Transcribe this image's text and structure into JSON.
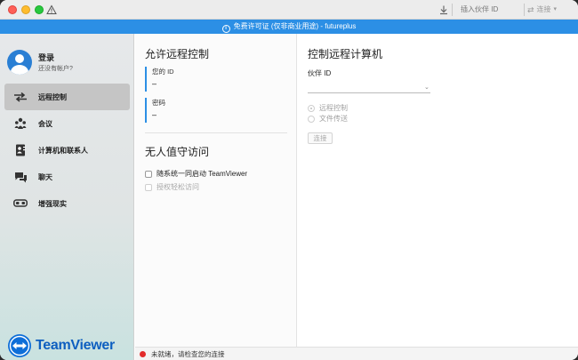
{
  "titlebar": {
    "partner_id_placeholder": "插入伙伴 ID",
    "connect_label": "连接"
  },
  "banner": {
    "text": "免费许可证 (仅非商业用途) - futureplus",
    "color": "#2c8fe5"
  },
  "profile": {
    "name": "登录",
    "subtitle": "还没有帐户?"
  },
  "sidebar": {
    "items": [
      {
        "label": "远程控制",
        "icon": "arrows-icon",
        "active": true
      },
      {
        "label": "会议",
        "icon": "people-icon",
        "active": false
      },
      {
        "label": "计算机和联系人",
        "icon": "contacts-icon",
        "active": false
      },
      {
        "label": "聊天",
        "icon": "chat-icon",
        "active": false
      },
      {
        "label": "增强现实",
        "icon": "ar-glasses-icon",
        "active": false
      }
    ],
    "logo_text": "TeamViewer"
  },
  "allow": {
    "title": "允许远程控制",
    "id_label": "您的 ID",
    "id_value": "–",
    "password_label": "密码",
    "password_value": "–"
  },
  "unattended": {
    "title": "无人值守访问",
    "start_with_system": "随系统一同启动 TeamViewer",
    "grant_easy_access": "授权轻松访问"
  },
  "control": {
    "title": "控制远程计算机",
    "partner_id_label": "伙伴 ID",
    "partner_id_value": "",
    "mode_remote": "远程控制",
    "mode_file_transfer": "文件传送",
    "connect_button": "连接"
  },
  "status": {
    "text": "未就绪，请检查您的连接",
    "color": "#e32b2b"
  }
}
